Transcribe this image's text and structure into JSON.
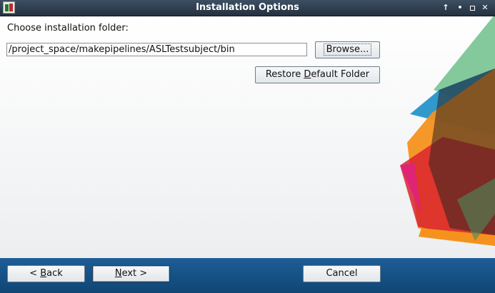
{
  "window": {
    "title": "Installation Options",
    "controls": {
      "up": "↑",
      "minimize": "•"
    }
  },
  "main": {
    "folder_label": "Choose installation folder:",
    "path_value": "/project_space/makepipelines/ASLTestsubject/bin",
    "browse_label": "Browse...",
    "restore_pre": "Restore ",
    "restore_accel": "D",
    "restore_post": "efault Folder"
  },
  "footer": {
    "back_pre": "< ",
    "back_accel": "B",
    "back_post": "ack",
    "next_accel": "N",
    "next_post": "ext >",
    "cancel_label": "Cancel"
  },
  "colors": {
    "titlebar": "#2d3b4a",
    "footer": "#17558a",
    "green": "#6fc08a",
    "blue": "#1b8fc6",
    "orange": "#f5921e",
    "red": "#d9232d",
    "magenta": "#e0217a",
    "dark": "#3a2a2a"
  }
}
